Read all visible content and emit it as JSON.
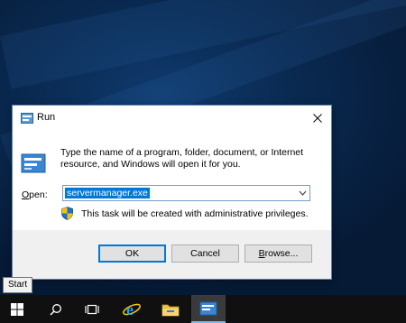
{
  "dialog": {
    "title": "Run",
    "description": "Type the name of a program, folder, document, or Internet resource, and Windows will open it for you.",
    "open_label_accel": "O",
    "open_label_rest": "pen:",
    "open_value": "servermanager.exe",
    "admin_note": "This task will be created with administrative privileges.",
    "buttons": {
      "ok": "OK",
      "cancel": "Cancel",
      "browse_accel": "B",
      "browse_rest": "rowse..."
    }
  },
  "tooltip": {
    "text": "Start"
  },
  "taskbar": {
    "items": [
      "windows-start-icon",
      "search-icon",
      "task-view-icon",
      "internet-explorer-icon",
      "file-explorer-icon",
      "run-icon"
    ]
  },
  "colors": {
    "accent": "#0078d7",
    "taskbar": "#101010",
    "dialog_footer": "#f0f0f0"
  }
}
